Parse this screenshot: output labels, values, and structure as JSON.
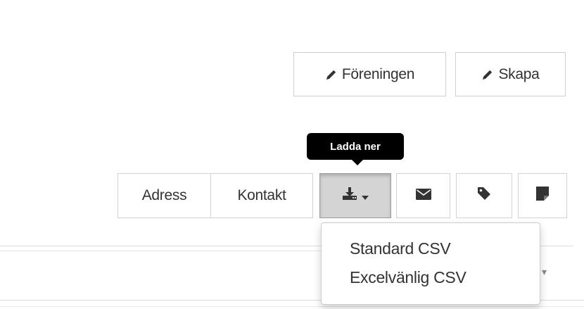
{
  "header_buttons": {
    "foreningen_label": "Föreningen",
    "skapa_label": "Skapa"
  },
  "toolbar": {
    "adress_label": "Adress",
    "kontakt_label": "Kontakt",
    "download_tooltip": "Ladda ner",
    "download_icon": "download-icon",
    "email_icon": "envelope-icon",
    "tag_icon": "tag-icon",
    "note_icon": "note-icon"
  },
  "download_menu": {
    "items": [
      {
        "label": "Standard CSV"
      },
      {
        "label": "Excelvänlig CSV"
      }
    ]
  },
  "colors": {
    "active_button_bg": "#d4d4d4",
    "tooltip_bg": "#000000",
    "border": "#cfcfcf",
    "icon": "#333333"
  }
}
